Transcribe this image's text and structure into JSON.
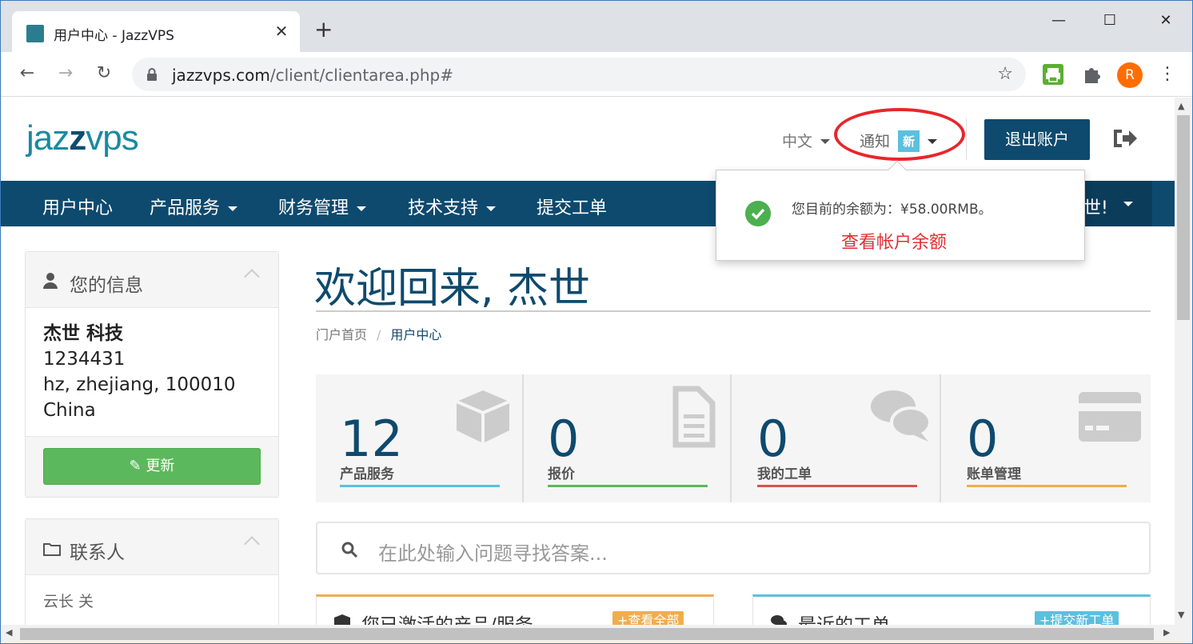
{
  "browser": {
    "tab_title": "用户中心 - JazzVPS",
    "url_domain": "jazzvps.com",
    "url_path": "/client/clientarea.php#",
    "profile_letter": "R"
  },
  "header": {
    "logo_part1": "jazz",
    "logo_part2": "z",
    "logo_part3": "vps",
    "language": "中文",
    "notifications_label": "通知",
    "notifications_badge": "新",
    "logout_label": "退出账户"
  },
  "navbar": {
    "items": [
      "用户中心",
      "产品服务",
      "财务管理",
      "技术支持",
      "提交工单"
    ],
    "right_label": "世!"
  },
  "popup": {
    "message": "您目前的余额为：¥58.00RMB。",
    "link": "查看帐户余额"
  },
  "sidebar": {
    "info_title": "您的信息",
    "info_lines": [
      "杰世 科技",
      "1234431",
      "hz, zhejiang, 100010",
      "China"
    ],
    "update_label": "更新",
    "contacts_title": "联系人",
    "contacts": [
      "云长 关"
    ]
  },
  "main": {
    "welcome": "欢迎回来, 杰世",
    "breadcrumb": [
      "门户首页",
      "用户中心"
    ],
    "tiles": [
      {
        "value": "12",
        "label": "产品服务",
        "color": "#5bc0de",
        "icon": "cube-icon"
      },
      {
        "value": "0",
        "label": "报价",
        "color": "#5cb85c",
        "icon": "document-icon"
      },
      {
        "value": "0",
        "label": "我的工单",
        "color": "#d9534f",
        "icon": "comments-icon"
      },
      {
        "value": "0",
        "label": "账单管理",
        "color": "#f0ad4e",
        "icon": "credit-card-icon"
      }
    ],
    "search_placeholder": "在此处输入问题寻找答案...",
    "cards": [
      {
        "title": "您已激活的产品/服务",
        "button": "查看全部",
        "color": "#f0ad4e"
      },
      {
        "title": "最近的工单",
        "button": "提交新工单",
        "color": "#5bc0de"
      }
    ]
  }
}
